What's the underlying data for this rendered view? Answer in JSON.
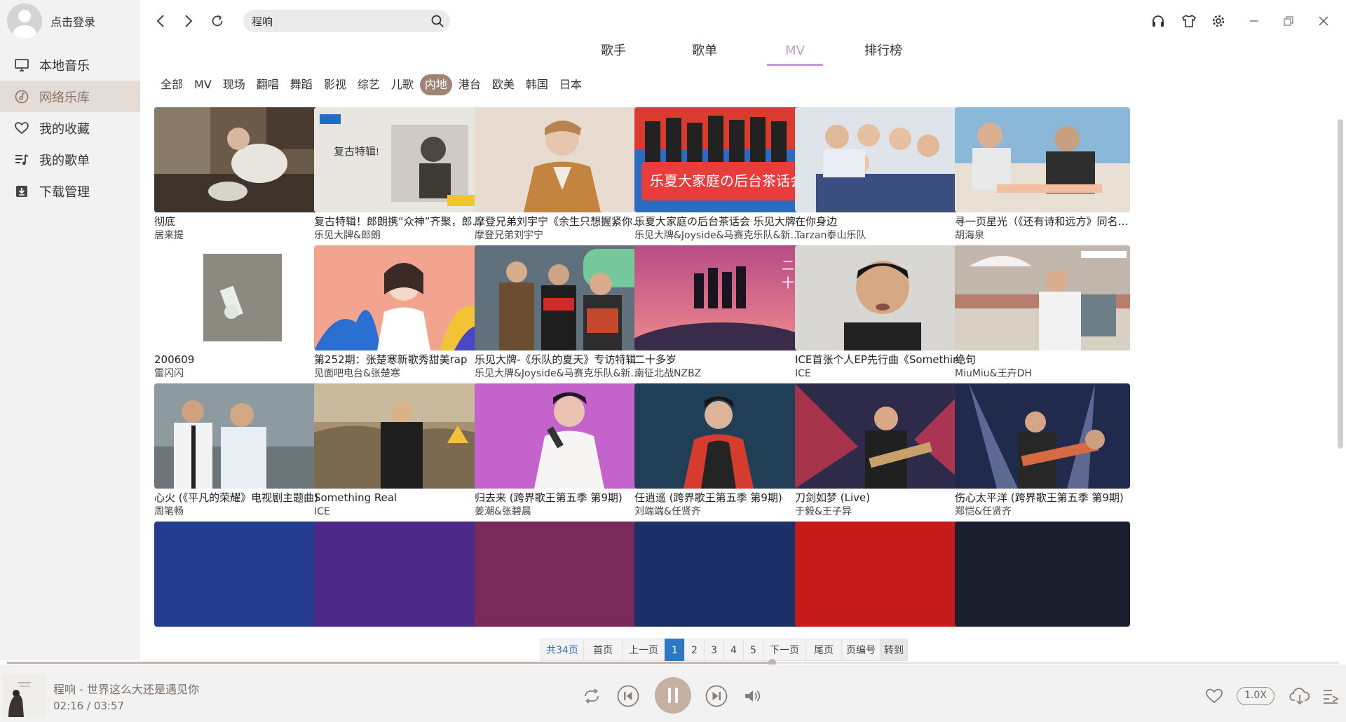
{
  "user": {
    "login_label": "点击登录"
  },
  "sidebar": {
    "items": [
      {
        "label": "本地音乐",
        "icon": "monitor-icon"
      },
      {
        "label": "网络乐库",
        "icon": "music-disc-icon"
      },
      {
        "label": "我的收藏",
        "icon": "heart-icon"
      },
      {
        "label": "我的歌单",
        "icon": "playlist-icon"
      },
      {
        "label": "下载管理",
        "icon": "download-icon"
      }
    ],
    "active_index": 1
  },
  "search": {
    "value": "程响",
    "placeholder": ""
  },
  "tabs": [
    "歌手",
    "歌单",
    "MV",
    "排行榜"
  ],
  "active_tab": "MV",
  "filters": [
    "全部",
    "MV",
    "现场",
    "翻唱",
    "舞蹈",
    "影视",
    "综艺",
    "儿歌",
    "内地",
    "港台",
    "欧美",
    "韩国",
    "日本"
  ],
  "active_filter": "内地",
  "mvs": [
    {
      "title": "彻底",
      "artist": "居来提"
    },
    {
      "title": "复古特辑！郎朗携“众神”齐聚，郎朗携“众神”齐聚",
      "artist": "乐见大牌&郎朗"
    },
    {
      "title": "摩登兄弟刘宇宁《余生只想握紧你的手》",
      "artist": "摩登兄弟刘宇宁"
    },
    {
      "title": "乐夏大家庭の后台茶话会 乐见大牌",
      "artist": "乐见大牌&Joyside&马赛克乐队&新裤子"
    },
    {
      "title": "在你身边",
      "artist": "Tarzan泰山乐队"
    },
    {
      "title": "寻一页星光（《还有诗和远方》同名推广曲）",
      "artist": "胡海泉"
    },
    {
      "title": "200609",
      "artist": "雷闪闪"
    },
    {
      "title": "第252期：张楚寒新歌秀甜美rap",
      "artist": "见面吧电台&张楚寒"
    },
    {
      "title": "乐见大牌-《乐队的夏天》专访特辑",
      "artist": "乐见大牌&Joyside&马赛克乐队&新裤子"
    },
    {
      "title": "二十多岁",
      "artist": "南征北战NZBZ"
    },
    {
      "title": "ICE首张个人EP先行曲《Something Real》",
      "artist": "ICE"
    },
    {
      "title": "绝句",
      "artist": "MiuMiu&王卉DH"
    },
    {
      "title": "心火 (《平凡的荣耀》电视剧主题曲)",
      "artist": "周笔畅"
    },
    {
      "title": "Something Real",
      "artist": "ICE"
    },
    {
      "title": "归去来 (跨界歌王第五季 第9期)",
      "artist": "姜潮&张碧晨"
    },
    {
      "title": "任逍遥 (跨界歌王第五季 第9期)",
      "artist": "刘端端&任贤齐"
    },
    {
      "title": "刀剑如梦 (Live)",
      "artist": "于毅&王子异"
    },
    {
      "title": "伤心太平洋 (跨界歌王第五季 第9期)",
      "artist": "郑恺&任贤齐"
    }
  ],
  "pagination": {
    "total": "共34页",
    "first": "首页",
    "prev": "上一页",
    "pages": [
      "1",
      "2",
      "3",
      "4",
      "5"
    ],
    "current": "1",
    "next": "下一页",
    "last": "尾页",
    "page_input": "页编号",
    "go": "转到"
  },
  "player": {
    "now_playing": "程响 - 世界这么大还是遇见你",
    "elapsed": "02:16",
    "duration": "03:57",
    "time_display": "02:16 / 03:57",
    "progress": 0.574,
    "speed": "1.0X"
  },
  "colors": {
    "accent_tab": "#c69ad6",
    "chip_active": "#a08576",
    "sidebar_active": "#e2dbd6",
    "page_current": "#2d78c1",
    "play_button": "#c5b0a2"
  }
}
